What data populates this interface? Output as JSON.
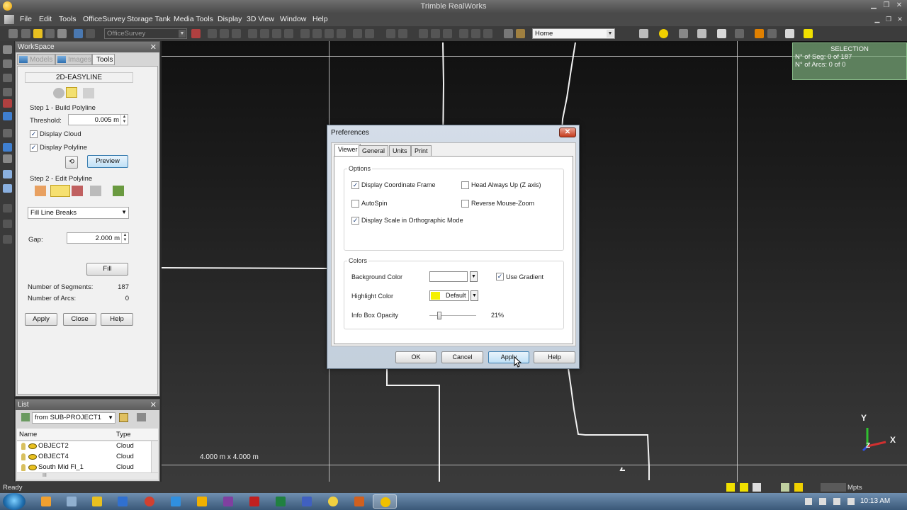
{
  "window": {
    "title": "Trimble RealWorks"
  },
  "menubar": {
    "items": [
      "File",
      "Edit",
      "Tools",
      "OfficeSurvey",
      "Storage Tank",
      "Media Tools",
      "Display",
      "3D View",
      "Window",
      "Help"
    ]
  },
  "toolbar": {
    "module_combo": "OfficeSurvey",
    "view_combo": "Home"
  },
  "workspace": {
    "title": "WorkSpace",
    "tabs": [
      "Models",
      "Images",
      "Tools"
    ],
    "tool": {
      "name": "2D-EASYLINE",
      "step1": "Step 1 - Build Polyline",
      "threshold_label": "Threshold:",
      "threshold_value": "0.005 m",
      "display_cloud": "Display Cloud",
      "display_polyline": "Display Polyline",
      "preview": "Preview",
      "step2": "Step 2 - Edit Polyline",
      "mode": "Fill Line Breaks",
      "gap_label": "Gap:",
      "gap_value": "2.000 m",
      "fill": "Fill",
      "segments_label": "Number of Segments:",
      "segments_value": "187",
      "arcs_label": "Number of Arcs:",
      "arcs_value": "0",
      "apply": "Apply",
      "close": "Close",
      "help": "Help"
    }
  },
  "list": {
    "title": "List",
    "source": "from SUB-PROJECT1",
    "columns": [
      "Name",
      "Type"
    ],
    "rows": [
      {
        "name": "OBJECT2",
        "type": "Cloud"
      },
      {
        "name": "OBJECT4",
        "type": "Cloud"
      },
      {
        "name": "South Mid Fl_1",
        "type": "Cloud"
      }
    ],
    "scroll_label": "III"
  },
  "viewport": {
    "scale": "4.000 m x 4.000 m",
    "selection": {
      "title": "SELECTION",
      "seg": "N° of Seg: 0 of 187",
      "arcs": "N° of Arcs: 0 of 0"
    },
    "axes": {
      "y": "Y",
      "x": "X",
      "z": "Z"
    }
  },
  "dialog": {
    "title": "Preferences",
    "tabs": [
      "Viewer",
      "General",
      "Units",
      "Print"
    ],
    "options_group": "Options",
    "opt_coord_frame": "Display Coordinate Frame",
    "opt_head_up": "Head Always Up (Z axis)",
    "opt_autospin": "AutoSpin",
    "opt_reverse_zoom": "Reverse Mouse-Zoom",
    "opt_scale_ortho": "Display Scale in Orthographic Mode",
    "colors_group": "Colors",
    "bg_color_label": "Background Color",
    "use_gradient": "Use Gradient",
    "highlight_label": "Highlight Color",
    "highlight_value": "Default",
    "opacity_label": "Info Box Opacity",
    "opacity_value": "21%",
    "opacity_fraction": 0.21,
    "ok": "OK",
    "cancel": "Cancel",
    "apply": "Apply",
    "help": "Help",
    "close_glyph": "✕",
    "highlight_hex": "#f5f000"
  },
  "status": {
    "left": "Ready",
    "units": "Mpts"
  },
  "taskbar": {
    "time": "10:13 AM"
  }
}
